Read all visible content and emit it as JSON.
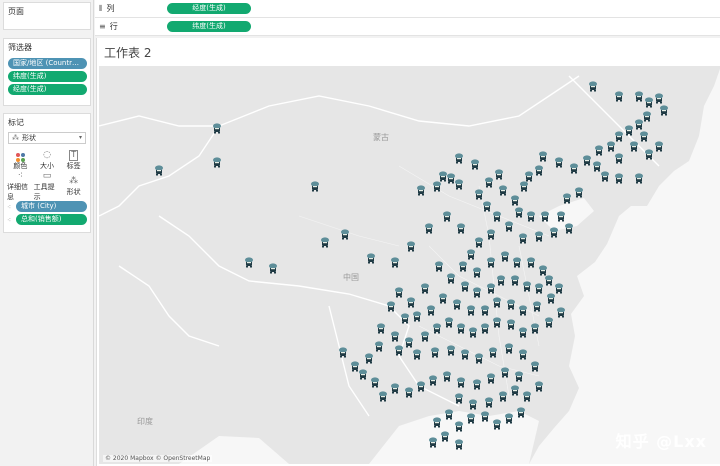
{
  "pages_panel": {
    "title": "页面"
  },
  "filters_panel": {
    "title": "筛选器",
    "pills": [
      "国家/地区 (Country): ...",
      "纬度(生成)",
      "经度(生成)"
    ]
  },
  "marks_panel": {
    "title": "标记",
    "mark_type": "形状",
    "buttons": [
      {
        "label": "颜色",
        "icon": "color-dots-icon"
      },
      {
        "label": "大小",
        "icon": "size-icon"
      },
      {
        "label": "标签",
        "icon": "label-icon"
      },
      {
        "label": "详细信息",
        "icon": "detail-icon"
      },
      {
        "label": "工具提示",
        "icon": "tooltip-icon"
      },
      {
        "label": "形状",
        "icon": "shape-icon"
      }
    ],
    "fields": [
      {
        "label": "城市 (City)",
        "color": "#4e93b4"
      },
      {
        "label": "总和(销售额)",
        "color": "#12a970"
      }
    ]
  },
  "shelves": {
    "columns": {
      "label": "列",
      "pill": "经度(生成)"
    },
    "rows": {
      "label": "行",
      "pill": "纬度(生成)"
    }
  },
  "sheet": {
    "title": "工作表 2"
  },
  "map": {
    "labels": {
      "mongolia": "蒙古",
      "china": "中国",
      "india": "印度"
    },
    "attribution": "© 2020 Mapbox © OpenStreetMap",
    "watermark": "知乎 @Lxx",
    "colors": {
      "land": "#e6e6e6",
      "sea": "#f7f7f7",
      "border": "#ffffff",
      "marker_body": "#1f3a44",
      "marker_head": "#5e8e99",
      "marker_eye": "#e8efe6"
    }
  }
}
